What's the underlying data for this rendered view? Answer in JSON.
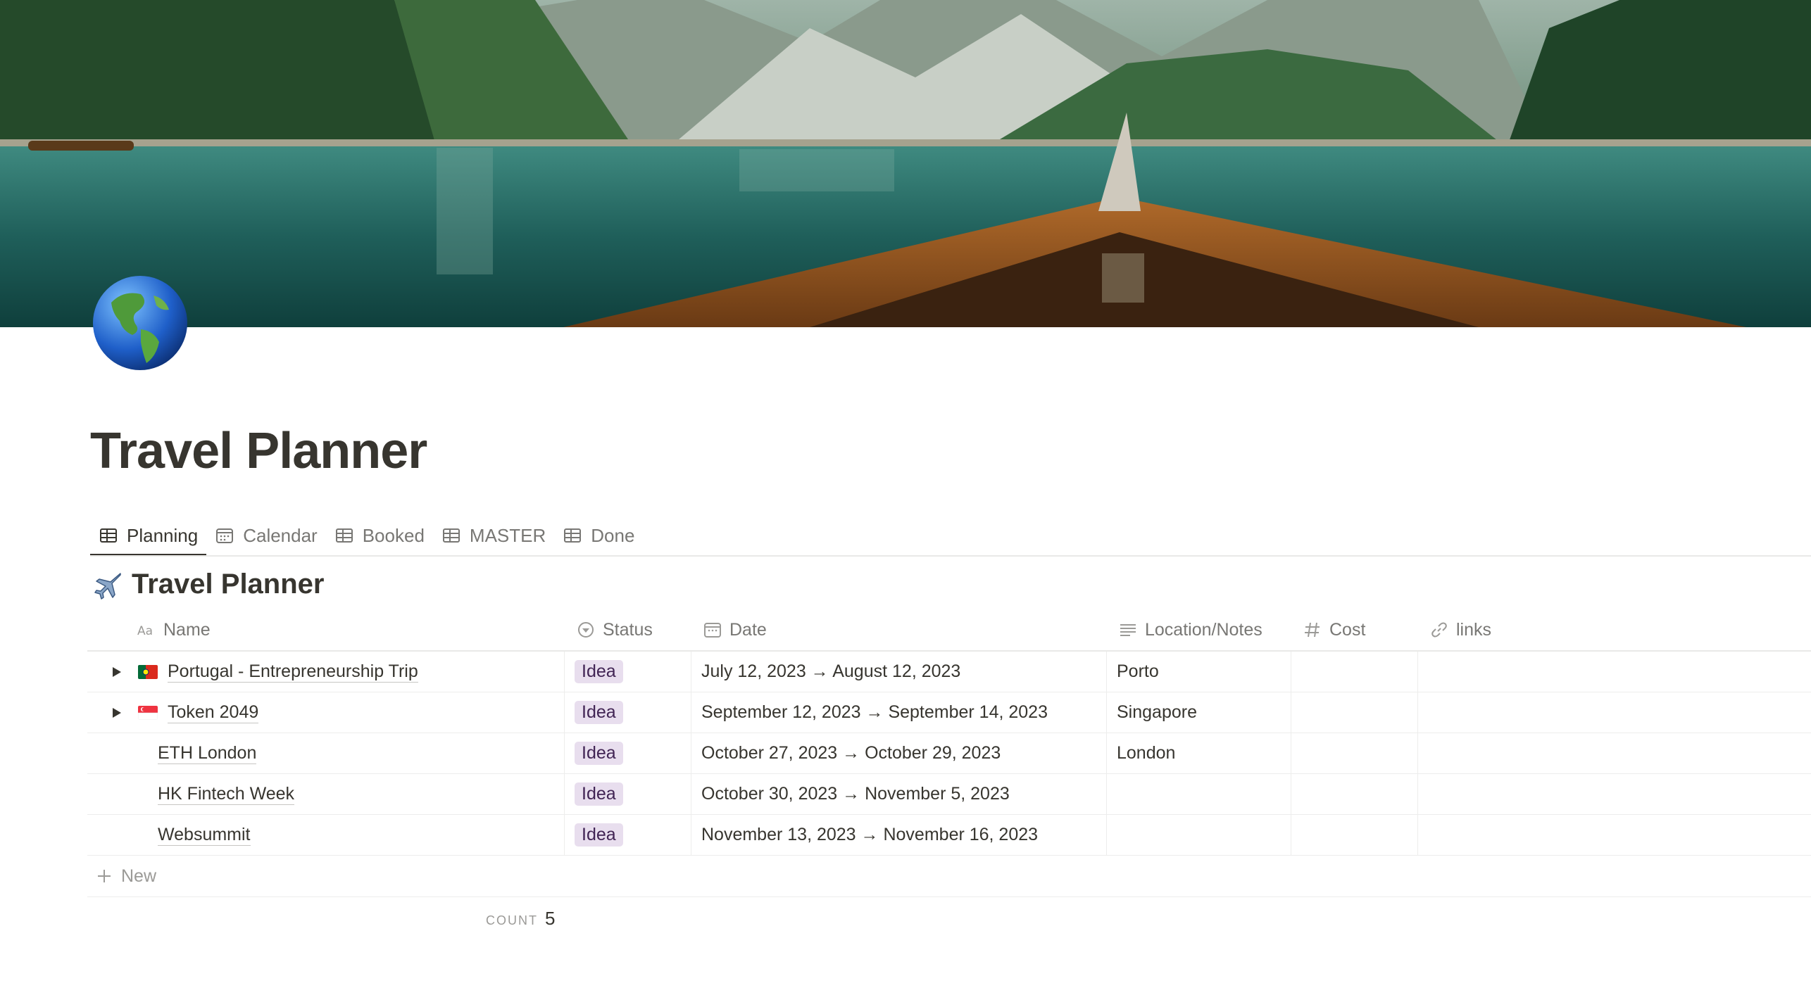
{
  "page": {
    "title": "Travel Planner",
    "icon": "globe-americas-icon"
  },
  "tabs": [
    {
      "label": "Planning",
      "icon": "table-icon",
      "active": true
    },
    {
      "label": "Calendar",
      "icon": "calendar-icon",
      "active": false
    },
    {
      "label": "Booked",
      "icon": "table-icon",
      "active": false
    },
    {
      "label": "MASTER",
      "icon": "table-icon",
      "active": false
    },
    {
      "label": "Done",
      "icon": "table-icon",
      "active": false
    }
  ],
  "view": {
    "title": "Travel Planner",
    "icon": "airplane-icon"
  },
  "columns": {
    "name": {
      "label": "Name",
      "icon": "text-aa-icon"
    },
    "status": {
      "label": "Status",
      "icon": "status-icon"
    },
    "date": {
      "label": "Date",
      "icon": "calendar-icon"
    },
    "location": {
      "label": "Location/Notes",
      "icon": "lines-icon"
    },
    "cost": {
      "label": "Cost",
      "icon": "hash-icon"
    },
    "links": {
      "label": "links",
      "icon": "link-icon"
    }
  },
  "rows": [
    {
      "name": "Portugal - Entrepreneurship Trip",
      "flag": "portugal-flag",
      "toggle": true,
      "status": "Idea",
      "date": "July 12, 2023 → August 12, 2023",
      "location": "Porto",
      "cost": "",
      "links": ""
    },
    {
      "name": "Token 2049",
      "flag": "singapore-flag",
      "toggle": true,
      "status": "Idea",
      "date": "September 12, 2023 → September 14, 2023",
      "location": "Singapore",
      "cost": "",
      "links": ""
    },
    {
      "name": "ETH London",
      "flag": "",
      "toggle": false,
      "status": "Idea",
      "date": "October 27, 2023 → October 29, 2023",
      "location": "London",
      "cost": "",
      "links": ""
    },
    {
      "name": "HK Fintech Week",
      "flag": "",
      "toggle": false,
      "status": "Idea",
      "date": "October 30, 2023 → November 5, 2023",
      "location": "",
      "cost": "",
      "links": ""
    },
    {
      "name": "Websummit",
      "flag": "",
      "toggle": false,
      "status": "Idea",
      "date": "November 13, 2023 → November 16, 2023",
      "location": "",
      "cost": "",
      "links": ""
    }
  ],
  "new_label": "New",
  "footer": {
    "count_label": "COUNT",
    "count_value": "5"
  },
  "colors": {
    "text": "#37352f",
    "muted": "#787774",
    "tag_bg": "#e8deee",
    "tag_text": "#412454"
  }
}
